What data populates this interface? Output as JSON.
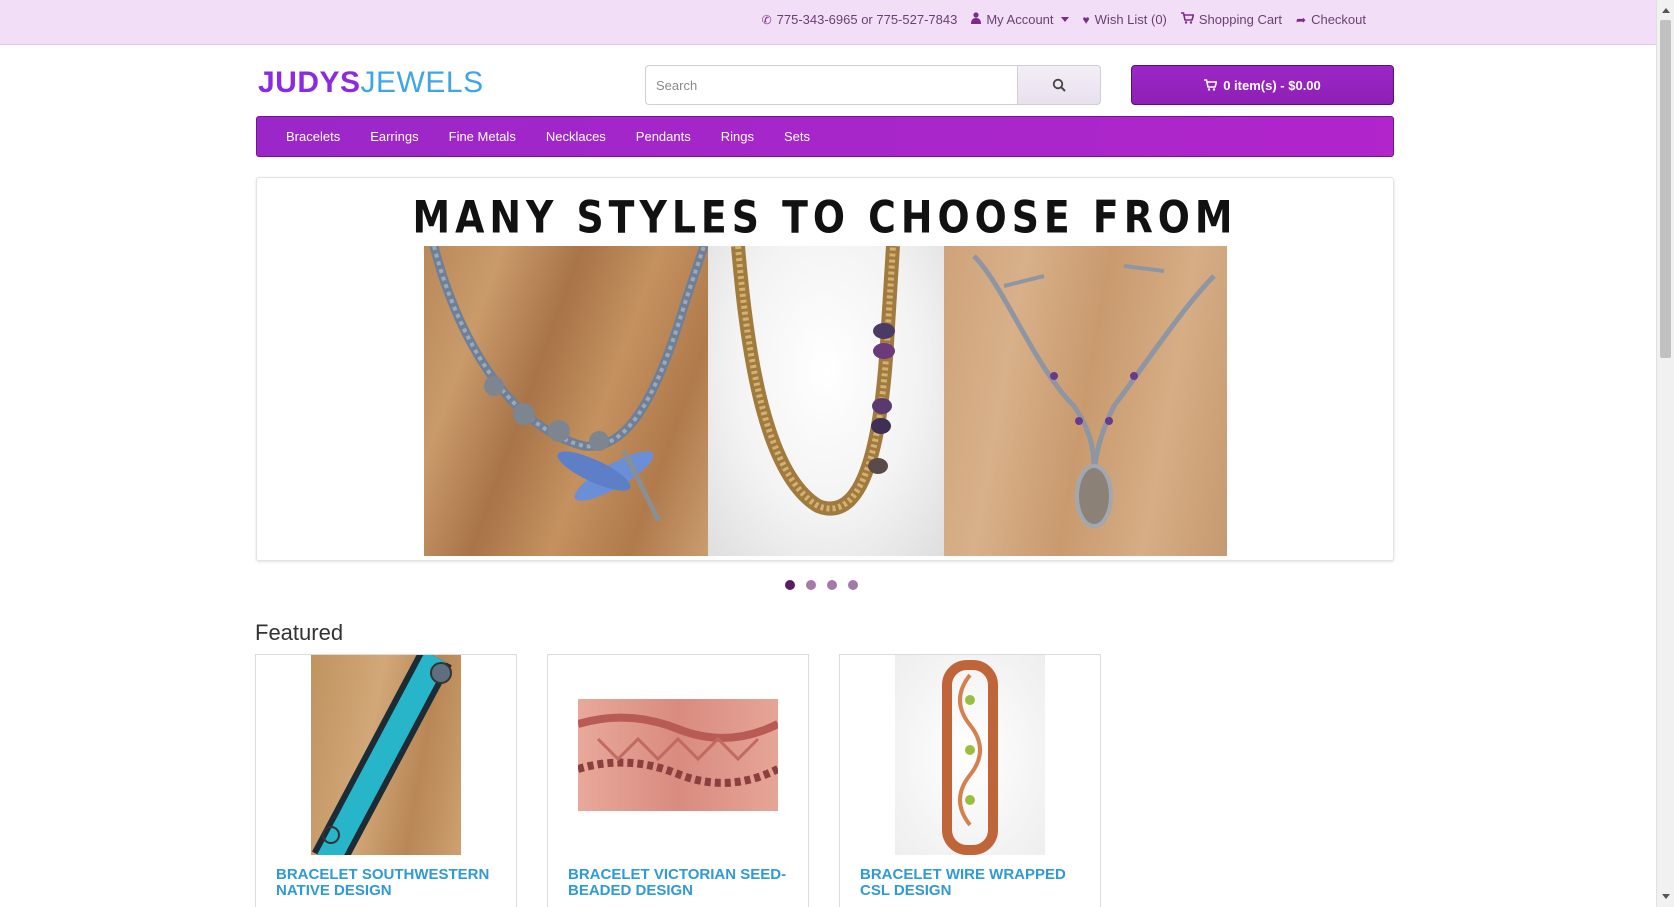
{
  "topbar": {
    "phone": "775-343-6965 or 775-527-7843",
    "my_account": "My Account",
    "wish_list": "Wish List (0)",
    "shopping_cart": "Shopping Cart",
    "checkout": "Checkout"
  },
  "header": {
    "logo_part1": "JUDYS",
    "logo_part2": "JEWELS",
    "search_placeholder": "Search",
    "cart_label": "0 item(s) - $0.00"
  },
  "nav": {
    "items": [
      "Bracelets",
      "Earrings",
      "Fine Metals",
      "Necklaces",
      "Pendants",
      "Rings",
      "Sets"
    ]
  },
  "banner": {
    "title": "MANY STYLES TO CHOOSE FROM",
    "slide_count": 4,
    "active_slide": 1
  },
  "featured": {
    "title": "Featured",
    "products": [
      {
        "name": "BRACELET SOUTHWESTERN NATIVE DESIGN"
      },
      {
        "name": "BRACELET VICTORIAN SEED-BEADED DESIGN"
      },
      {
        "name": "BRACELET WIRE WRAPPED CSL DESIGN"
      }
    ]
  },
  "colors": {
    "topbar_bg": "#f3def8",
    "brand_purple": "#9b27c8",
    "logo_purple": "#8a2be2",
    "logo_blue": "#3ea6e6",
    "product_link": "#2f9ad6"
  }
}
